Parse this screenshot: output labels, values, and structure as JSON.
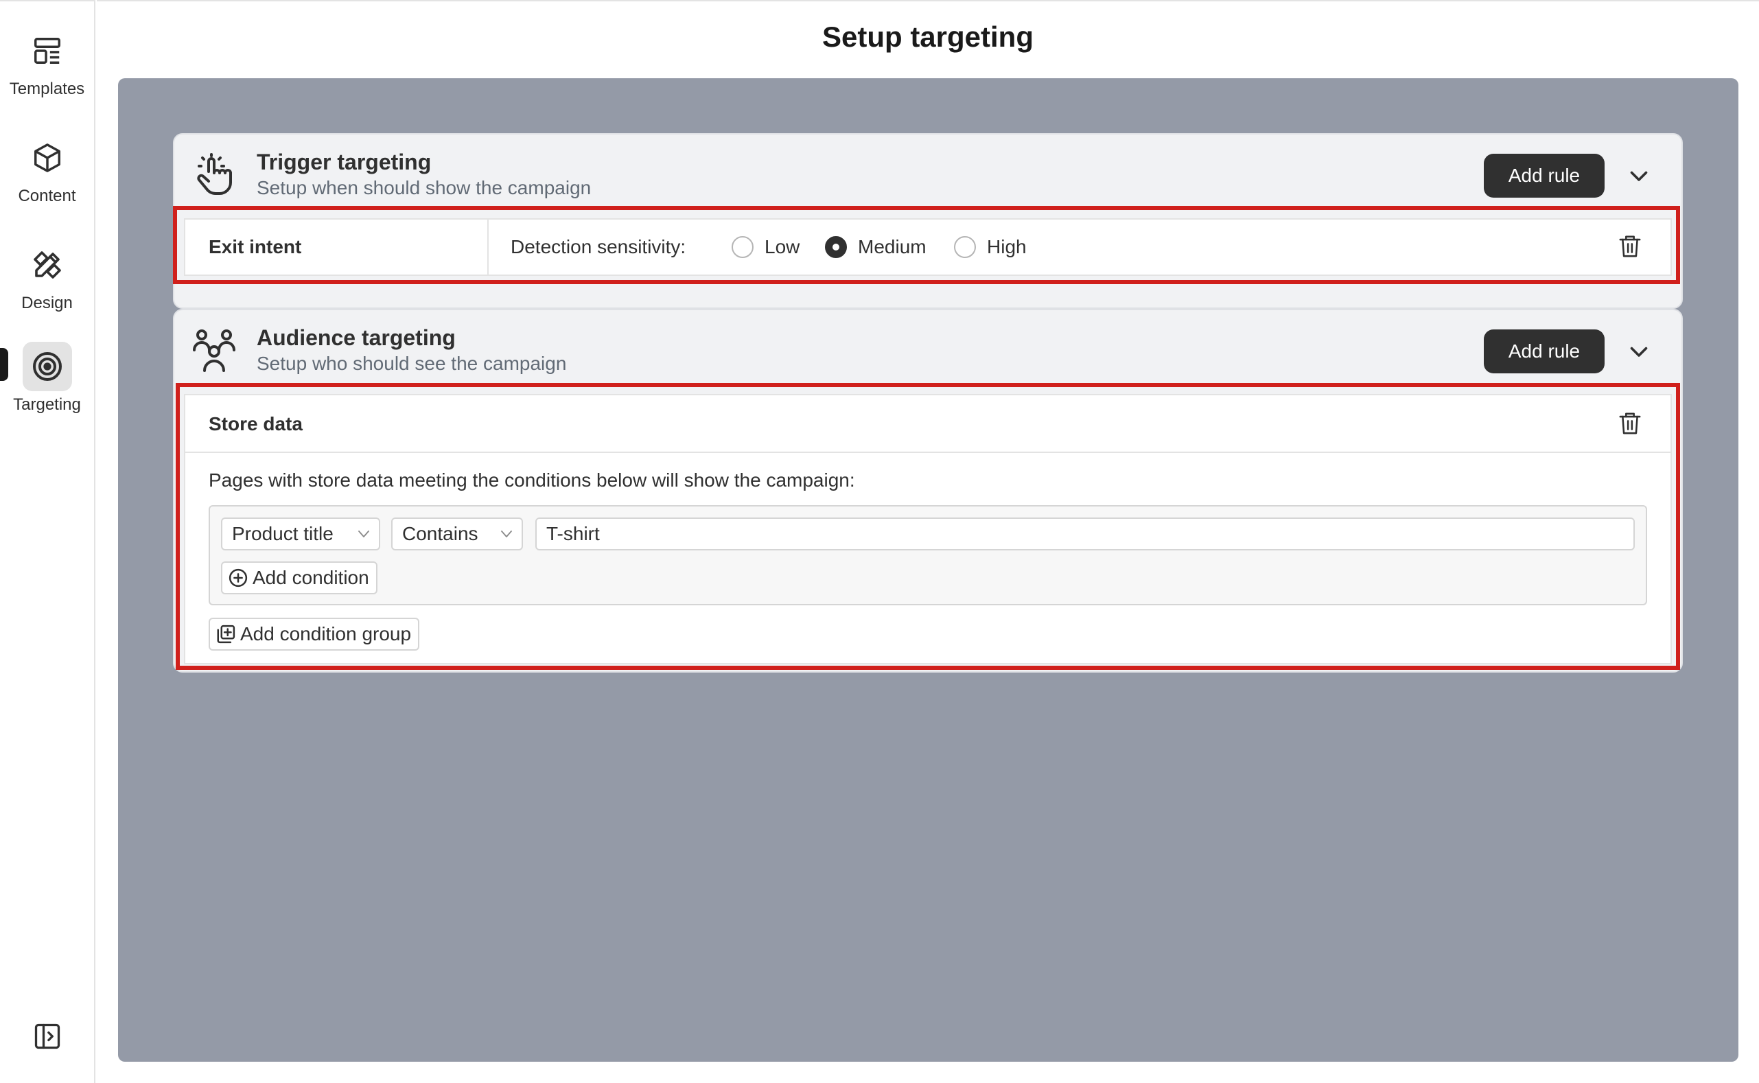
{
  "page": {
    "title": "Setup targeting"
  },
  "sidebar": {
    "items": [
      {
        "label": "Templates",
        "icon": "templates-icon",
        "active": false
      },
      {
        "label": "Content",
        "icon": "cube-icon",
        "active": false
      },
      {
        "label": "Design",
        "icon": "design-tools-icon",
        "active": false
      },
      {
        "label": "Targeting",
        "icon": "target-icon",
        "active": true
      }
    ],
    "collapse_icon": "sidebar-collapse-icon"
  },
  "trigger": {
    "title": "Trigger targeting",
    "subtitle": "Setup when should show the campaign",
    "add_rule_label": "Add rule",
    "rule": {
      "name": "Exit intent",
      "sensitivity_label": "Detection sensitivity:",
      "options": [
        "Low",
        "Medium",
        "High"
      ],
      "selected": "Medium"
    }
  },
  "audience": {
    "title": "Audience targeting",
    "subtitle": "Setup who should see the campaign",
    "add_rule_label": "Add rule",
    "rule": {
      "name": "Store data",
      "description": "Pages with store data meeting the conditions below will show the campaign:",
      "condition": {
        "field": "Product title",
        "operator": "Contains",
        "value": "T-shirt"
      },
      "add_condition_label": "Add condition",
      "add_group_label": "Add condition group"
    }
  },
  "colors": {
    "canvas": "#949aa7",
    "highlight": "#d0201c",
    "button_dark": "#303030"
  }
}
